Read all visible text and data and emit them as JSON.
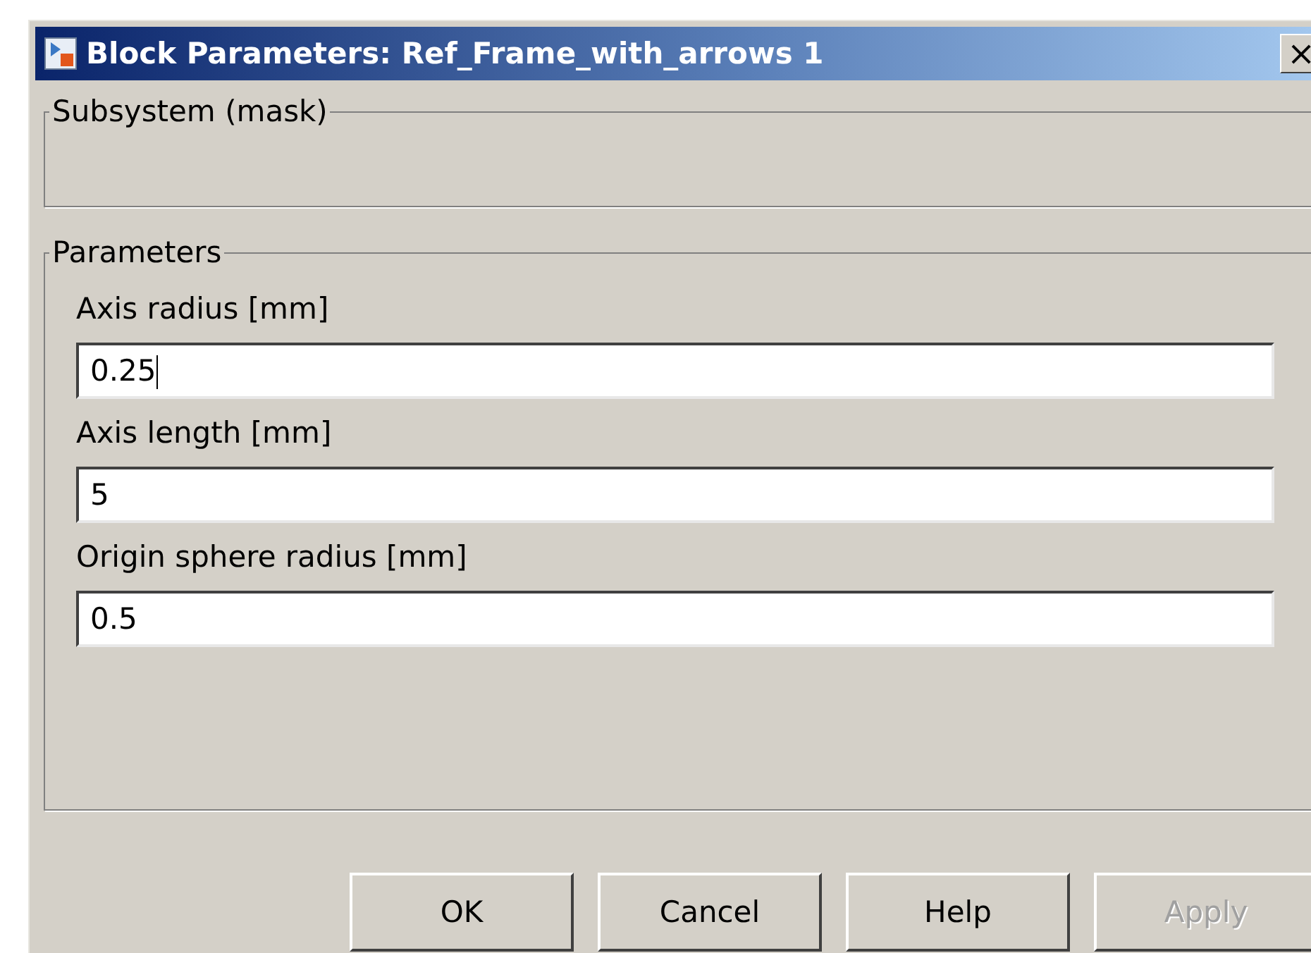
{
  "window": {
    "title": "Block Parameters: Ref_Frame_with_arrows 1",
    "close": "×"
  },
  "groups": [
    {
      "title": "Subsystem (mask)"
    },
    {
      "title": "Parameters",
      "fields": [
        {
          "label": "Axis radius [mm]",
          "value": "0.25",
          "focused": true
        },
        {
          "label": "Axis length [mm]",
          "value": "5",
          "focused": false
        },
        {
          "label": "Origin sphere radius [mm]",
          "value": "0.5",
          "focused": false
        }
      ]
    }
  ],
  "buttons": [
    {
      "label": "OK",
      "disabled": false
    },
    {
      "label": "Cancel",
      "disabled": false
    },
    {
      "label": "Help",
      "disabled": false
    },
    {
      "label": "Apply",
      "disabled": true
    }
  ]
}
